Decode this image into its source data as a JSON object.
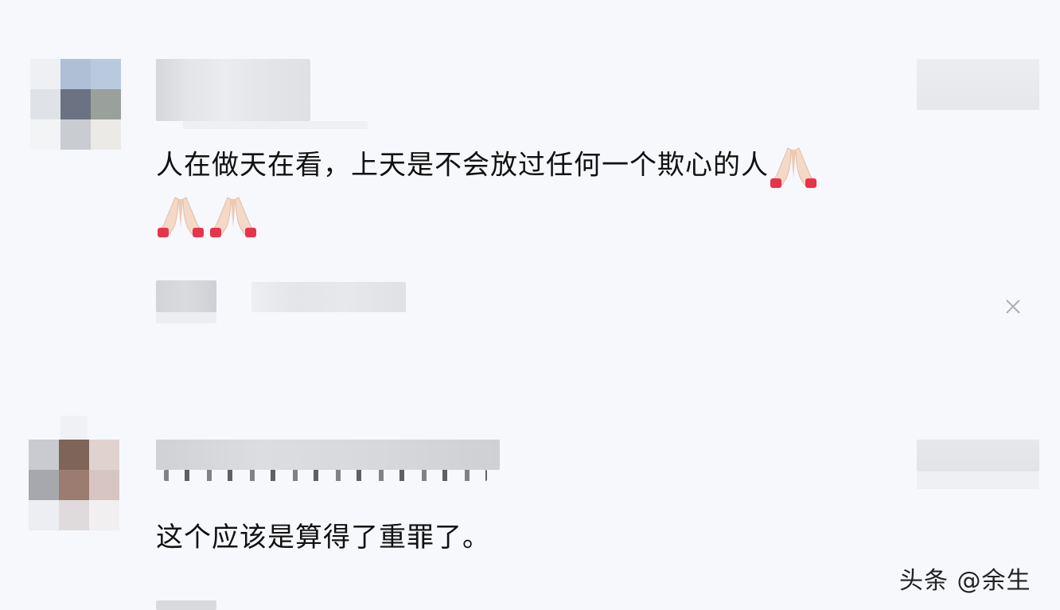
{
  "comments": [
    {
      "text": "人在做天在看，上天是不会放过任何一个欺心的人",
      "emoji_count": 3,
      "emoji_icon": "folded-hands-icon"
    },
    {
      "text": "这个应该是算得了重罪了。"
    }
  ],
  "watermark": "头条 @余生",
  "colors": {
    "background": "#f6f8fc",
    "text": "#111111",
    "emoji_skin": "#f4d9c6",
    "emoji_sleeve": "#e8344a"
  }
}
